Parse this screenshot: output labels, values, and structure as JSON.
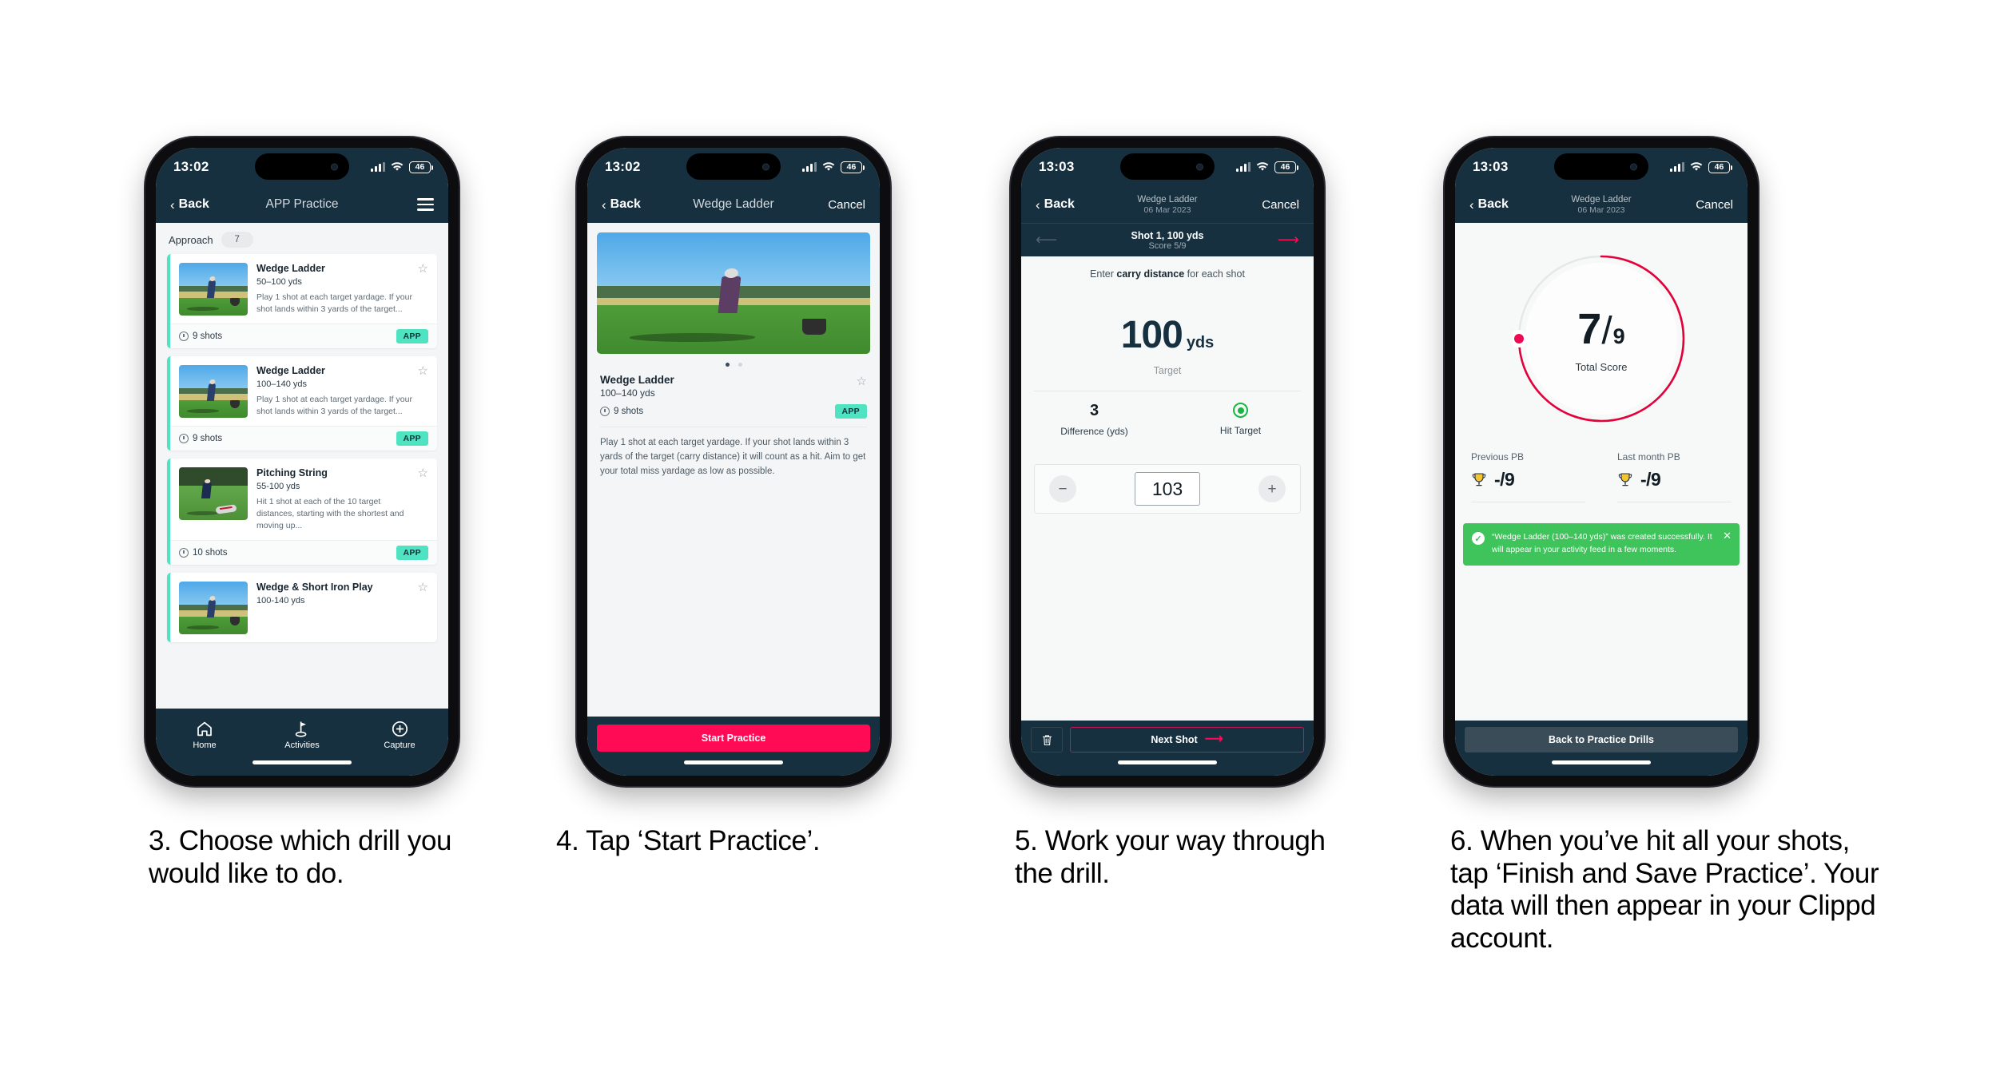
{
  "phones": [
    {
      "id": "phone-drill-list",
      "status": {
        "time": "13:02",
        "battery": "46"
      },
      "nav": {
        "back": "Back",
        "title": "APP Practice"
      },
      "section": {
        "label": "Approach",
        "count": "7"
      },
      "cards": [
        {
          "title": "Wedge Ladder",
          "range": "50–100 yds",
          "desc": "Play 1 shot at each target yardage. If your shot lands within 3 yards of the target...",
          "shots": "9 shots",
          "badge": "APP"
        },
        {
          "title": "Wedge Ladder",
          "range": "100–140 yds",
          "desc": "Play 1 shot at each target yardage. If your shot lands within 3 yards of the target...",
          "shots": "9 shots",
          "badge": "APP"
        },
        {
          "title": "Pitching String",
          "range": "55-100 yds",
          "desc": "Hit 1 shot at each of the 10 target distances, starting with the shortest and moving up...",
          "shots": "10 shots",
          "badge": "APP"
        },
        {
          "title": "Wedge & Short Iron Play",
          "range": "100-140 yds",
          "desc": "",
          "shots": "",
          "badge": ""
        }
      ],
      "tabs": [
        {
          "label": "Home",
          "icon": "home-icon"
        },
        {
          "label": "Activities",
          "icon": "golf-flag-icon"
        },
        {
          "label": "Capture",
          "icon": "plus-circle-icon"
        }
      ]
    },
    {
      "id": "phone-drill-detail",
      "status": {
        "time": "13:02",
        "battery": "46"
      },
      "nav": {
        "back": "Back",
        "title": "Wedge Ladder",
        "cancel": "Cancel"
      },
      "detail": {
        "title": "Wedge Ladder",
        "range": "100–140 yds",
        "shots": "9 shots",
        "badge": "APP",
        "description": "Play 1 shot at each target yardage. If your shot lands within 3 yards of the target (carry distance) it will count as a hit. Aim to get your total miss yardage as low as possible."
      },
      "cta": "Start Practice"
    },
    {
      "id": "phone-shot-entry",
      "status": {
        "time": "13:03",
        "battery": "46"
      },
      "nav": {
        "back": "Back",
        "title": "Wedge Ladder",
        "subtitle": "06 Mar 2023",
        "cancel": "Cancel"
      },
      "shotbar": {
        "title": "Shot 1, 100 yds",
        "score": "Score 5/9"
      },
      "prompt_pre": "Enter ",
      "prompt_bold": "carry distance",
      "prompt_post": " for each shot",
      "target": {
        "value": "100",
        "unit": "yds",
        "label": "Target"
      },
      "stats": [
        {
          "value": "3",
          "label": "Difference (yds)"
        },
        {
          "value": "",
          "label": "Hit Target"
        }
      ],
      "stepper": {
        "minus": "−",
        "value": "103",
        "plus": "+"
      },
      "footer": {
        "delete": "🗑",
        "next": "Next Shot"
      }
    },
    {
      "id": "phone-summary",
      "status": {
        "time": "13:03",
        "battery": "46"
      },
      "nav": {
        "back": "Back",
        "title": "Wedge Ladder",
        "subtitle": "06 Mar 2023",
        "cancel": "Cancel"
      },
      "gauge": {
        "score": "7",
        "slash": "/",
        "max": "9",
        "label": "Total Score",
        "percent": 78
      },
      "pbs": [
        {
          "label": "Previous PB",
          "value": "-/9"
        },
        {
          "label": "Last month PB",
          "value": "-/9"
        }
      ],
      "toast": {
        "message": "“Wedge Ladder (100–140 yds)” was created successfully. It will appear in your activity feed in a few moments.",
        "close": "✕"
      },
      "cta": "Back to Practice Drills"
    }
  ],
  "captions": [
    "3. Choose which drill you would like to do.",
    "4. Tap ‘Start Practice’.",
    "5. Work your way through the drill.",
    "6. When you’ve hit all your shots, tap ‘Finish and Save Practice’. Your data will then appear in your Clippd account."
  ],
  "colors": {
    "navy": "#17303f",
    "pink": "#ff0a55",
    "teal": "#4fe3c1",
    "green": "#3ec45a",
    "page": "#ffffff"
  }
}
